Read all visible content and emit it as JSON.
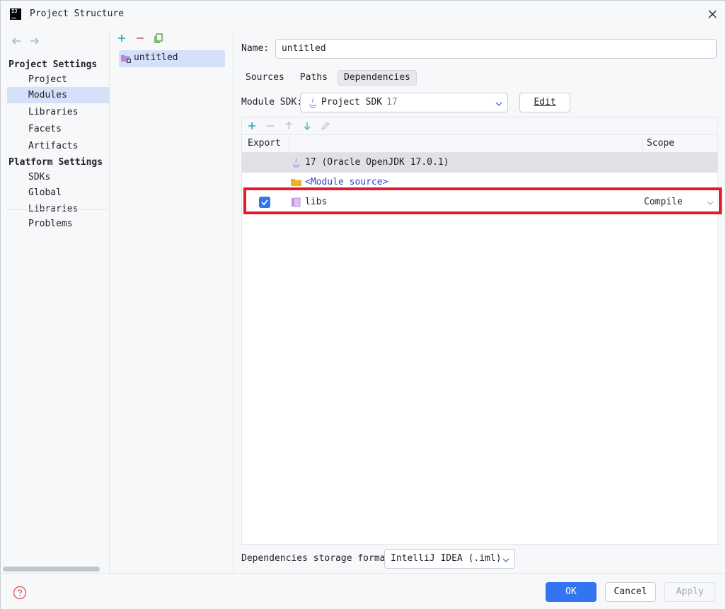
{
  "window": {
    "title": "Project Structure"
  },
  "nav": {
    "sections": [
      {
        "title": "Project Settings",
        "items": [
          "Project",
          "Modules",
          "Libraries",
          "Facets",
          "Artifacts"
        ]
      },
      {
        "title": "Platform Settings",
        "items": [
          "SDKs",
          "Global Libraries"
        ]
      }
    ],
    "problems": "Problems",
    "selected": "Modules"
  },
  "modules": {
    "items": [
      "untitled"
    ]
  },
  "main": {
    "name_label": "Name:",
    "name_value": "untitled",
    "tabs": [
      "Sources",
      "Paths",
      "Dependencies"
    ],
    "active_tab": "Dependencies",
    "sdk_label": "Module SDK:",
    "sdk_value": "Project SDK",
    "sdk_version": "17",
    "edit_label": "Edit",
    "table": {
      "headers": {
        "export": "Export",
        "scope": "Scope"
      },
      "rows": [
        {
          "name": "17 (Oracle OpenJDK 17.0.1)",
          "icon": "java-sdk-icon",
          "selected": true
        },
        {
          "name": "<Module source>",
          "icon": "folder-icon",
          "link": true
        },
        {
          "name": "libs",
          "icon": "library-icon",
          "export": true,
          "scope": "Compile"
        }
      ]
    },
    "storage_label": "Dependencies storage format:",
    "storage_value": "IntelliJ IDEA (.iml)"
  },
  "footer": {
    "ok": "OK",
    "cancel": "Cancel",
    "apply": "Apply"
  },
  "colors": {
    "accent": "#3574f0",
    "selection": "#d5e1fb",
    "highlight": "#e21a2c",
    "link": "#2a47c7"
  }
}
